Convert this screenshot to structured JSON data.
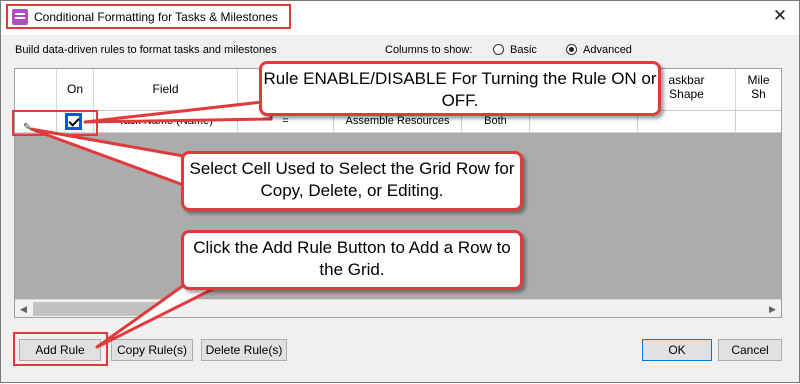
{
  "window": {
    "title": "Conditional Formatting for Tasks & Milestones",
    "close_glyph": "✕"
  },
  "toolbar": {
    "instructions": "Build data-driven rules to format tasks and milestones",
    "columns_label": "Columns to show:",
    "options": [
      {
        "label": "Basic",
        "selected": false
      },
      {
        "label": "Advanced",
        "selected": true
      }
    ]
  },
  "grid": {
    "columns": [
      "",
      "On",
      "Field",
      "",
      "",
      "",
      "",
      "askbar\nShape",
      "Mile\nSh"
    ],
    "rows": [
      {
        "select_glyph": "✎",
        "on": true,
        "field": "Task Name (Name)",
        "operator": "=",
        "value": "Assemble Resources",
        "apply_to": "Both"
      }
    ]
  },
  "buttons": {
    "add_rule": "Add Rule",
    "copy_rules": "Copy Rule(s)",
    "delete_rules": "Delete Rule(s)",
    "ok": "OK",
    "cancel": "Cancel"
  },
  "callouts": {
    "enable": "Rule ENABLE/DISABLE For Turning the Rule ON or OFF.",
    "select": "Select Cell Used to Select the Grid Row for Copy, Delete, or Editing.",
    "add": "Click the Add Rule Button to Add a Row to the Grid."
  },
  "colors": {
    "accent": "#e03a3a",
    "checkbox": "#0a5bd3"
  }
}
